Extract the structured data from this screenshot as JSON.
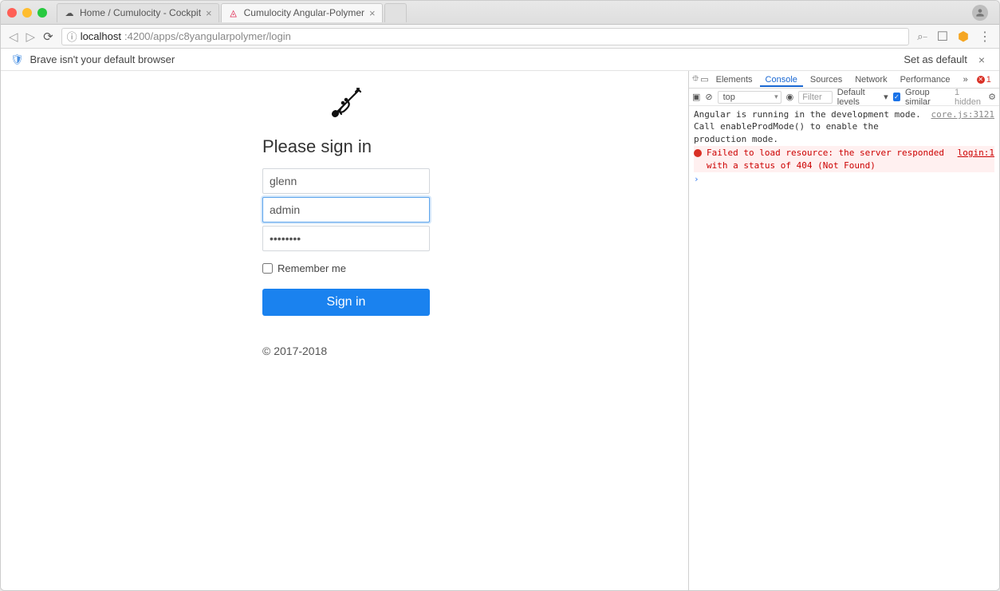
{
  "browser": {
    "tabs": [
      {
        "title": "Home / Cumulocity - Cockpit",
        "active": false,
        "favicon": "cloud"
      },
      {
        "title": "Cumulocity Angular-Polymer",
        "active": true,
        "favicon": "angular"
      }
    ],
    "address": {
      "host": "localhost",
      "port_path": ":4200/apps/c8yangularpolymer/login"
    },
    "infobar": {
      "message": "Brave isn't your default browser",
      "action": "Set as default"
    }
  },
  "login": {
    "title": "Please sign in",
    "tenant_value": "glenn",
    "username_value": "admin",
    "password_value": "••••••••",
    "remember_label": "Remember me",
    "submit_label": "Sign in",
    "footer": "© 2017-2018"
  },
  "devtools": {
    "tabs": [
      "Elements",
      "Console",
      "Sources",
      "Network",
      "Performance"
    ],
    "active_tab": "Console",
    "error_count": "1",
    "context": "top",
    "filter_placeholder": "Filter",
    "levels_label": "Default levels",
    "group_similar_label": "Group similar",
    "hidden_label": "1 hidden",
    "messages": [
      {
        "type": "info",
        "text": "Angular is running in the development mode. Call enableProdMode() to enable the production mode.",
        "source": "core.js:3121"
      },
      {
        "type": "error",
        "text": "Failed to load resource: the server responded with a status of 404 (Not Found)",
        "source": "login:1"
      }
    ]
  }
}
